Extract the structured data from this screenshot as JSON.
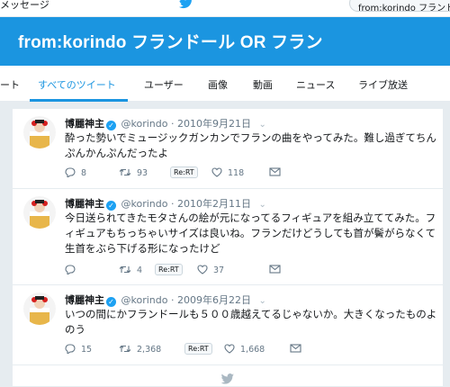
{
  "topbar": {
    "messages_label": "メッセージ",
    "search_value": "from:korindo フランドール"
  },
  "banner": {
    "title": "from:korindo フランドール OR フラン"
  },
  "tabs": [
    {
      "label": "ート",
      "active": false
    },
    {
      "label": "すべてのツイート",
      "active": true
    },
    {
      "label": "ユーザー",
      "active": false
    },
    {
      "label": "画像",
      "active": false
    },
    {
      "label": "動画",
      "active": false
    },
    {
      "label": "ニュース",
      "active": false
    },
    {
      "label": "ライブ放送",
      "active": false
    }
  ],
  "tweets": [
    {
      "name": "博麗神主",
      "handle": "@korindo",
      "date": "2010年9月21日",
      "text": "酔った勢いでミュージックガンカンでフランの曲をやってみた。難し過ぎてちんぷんかんぷんだったよ",
      "replies": "8",
      "retweets": "93",
      "likes": "118",
      "rt_badge": "Re:RT"
    },
    {
      "name": "博麗神主",
      "handle": "@korindo",
      "date": "2010年2月11日",
      "text": "今日送られてきたモタさんの絵が元になってるフィギュアを組み立ててみた。フィギュアもちっちゃいサイズは良いね。フランだけどうしても首が鬢がらなくて生首をぶら下げる形になったけど",
      "replies": "",
      "retweets": "4",
      "likes": "37",
      "rt_badge": "Re:RT"
    },
    {
      "name": "博麗神主",
      "handle": "@korindo",
      "date": "2009年6月22日",
      "text": "いつの間にかフランドールも５００歳越えてるじゃないか。大きくなったものよのう",
      "replies": "15",
      "retweets": "2,368",
      "likes": "1,668",
      "rt_badge": "Re:RT"
    }
  ],
  "colors": {
    "brand": "#1b95e0",
    "background": "#e6ecf0",
    "muted": "#657786"
  }
}
